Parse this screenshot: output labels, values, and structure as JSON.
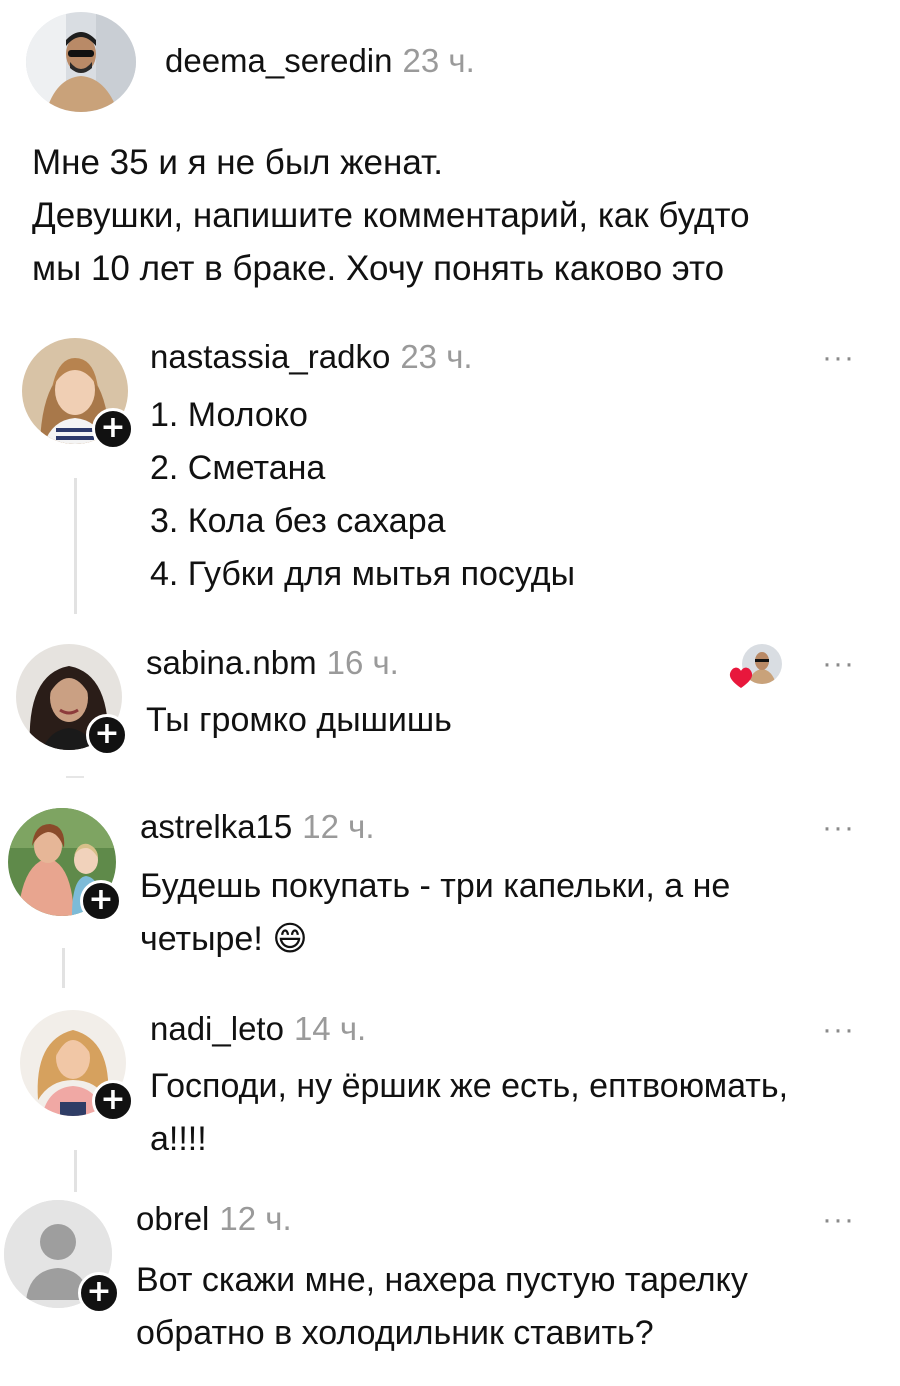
{
  "post": {
    "author": "deema_seredin",
    "time": "23 ч.",
    "lines": [
      "Мне 35 и я не был женат.",
      "Девушки, напишите комментарий, как будто",
      "мы 10 лет в браке. Хочу понять каково это"
    ]
  },
  "comments": [
    {
      "username": "nastassia_radko",
      "time": "23 ч.",
      "lines": [
        "1. Молоко",
        "2. Сметана",
        "3. Кола без сахара",
        "4. Губки для мытья посуды"
      ],
      "avatar_icon": "woman-portrait-blonde"
    },
    {
      "username": "sabina.nbm",
      "time": "16 ч.",
      "lines": [
        "Ты громко дышишь"
      ],
      "avatar_icon": "woman-portrait-dark-hair",
      "liked_by_author": true
    },
    {
      "username": "astrelka15",
      "time": "12 ч.",
      "lines": [
        "Будешь покупать - три капельки, а не",
        "четыре!"
      ],
      "emoji": "😄",
      "avatar_icon": "woman-with-child-portrait"
    },
    {
      "username": "nadi_leto",
      "time": "14 ч.",
      "lines": [
        "Господи, ну ёршик же есть, ептвоюмать,",
        "а!!!!"
      ],
      "avatar_icon": "woman-portrait-curly-hair"
    },
    {
      "username": "obrel",
      "time": "12 ч.",
      "lines": [
        "Вот скажи мне, нахера пустую тарелку",
        "обратно в холодильник ставить?"
      ],
      "avatar_icon": "default-user-placeholder"
    }
  ],
  "ui": {
    "follow_symbol": "+",
    "more_symbol": "···"
  },
  "colors": {
    "text": "#111111",
    "muted": "#9a9a9a",
    "like": "#e8173c",
    "thread_line": "#e2e2e2"
  }
}
